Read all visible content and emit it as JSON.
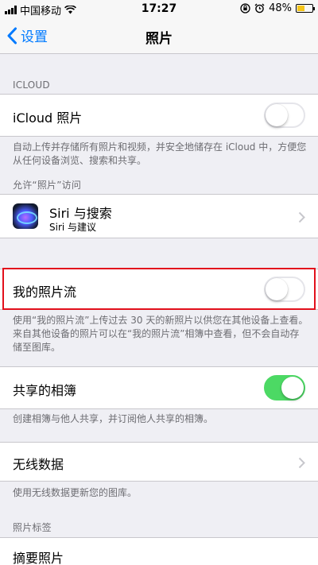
{
  "status_bar": {
    "carrier": "中国移动",
    "time": "17:27",
    "battery": "48%",
    "battery_level": 0.48,
    "icons": [
      "signal-icon",
      "wifi-icon",
      "orientation-lock-icon",
      "alarm-icon",
      "battery-icon"
    ]
  },
  "nav": {
    "back_label": "设置",
    "title": "照片"
  },
  "sections": {
    "icloud_header": "ICLOUD",
    "icloud_photos_label": "iCloud 照片",
    "icloud_photos_on": false,
    "icloud_footer": "自动上传并存储所有照片和视频，并安全地储存在 iCloud 中，方便您从任何设备浏览、搜索和共享。",
    "access_header": "允许“照片”访问",
    "siri_title": "Siri 与搜索",
    "siri_subtitle": "Siri 与建议",
    "photostream_label": "我的照片流",
    "photostream_on": false,
    "photostream_footer": "使用“我的照片流”上传过去 30 天的新照片以供您在其他设备上查看。来自其他设备的照片可以在“我的照片流”相簿中查看，但不会自动存储至图库。",
    "shared_albums_label": "共享的相簿",
    "shared_albums_on": true,
    "shared_albums_footer": "创建相簿与他人共享，并订阅他人共享的相簿。",
    "wireless_data_label": "无线数据",
    "wireless_data_footer": "使用无线数据更新您的图库。",
    "tags_header": "照片标签",
    "summary_label": "摘要照片"
  },
  "colors": {
    "accent": "#007aff",
    "toggle_on": "#4cd964",
    "highlight": "#e2101c",
    "background": "#efeff4"
  }
}
